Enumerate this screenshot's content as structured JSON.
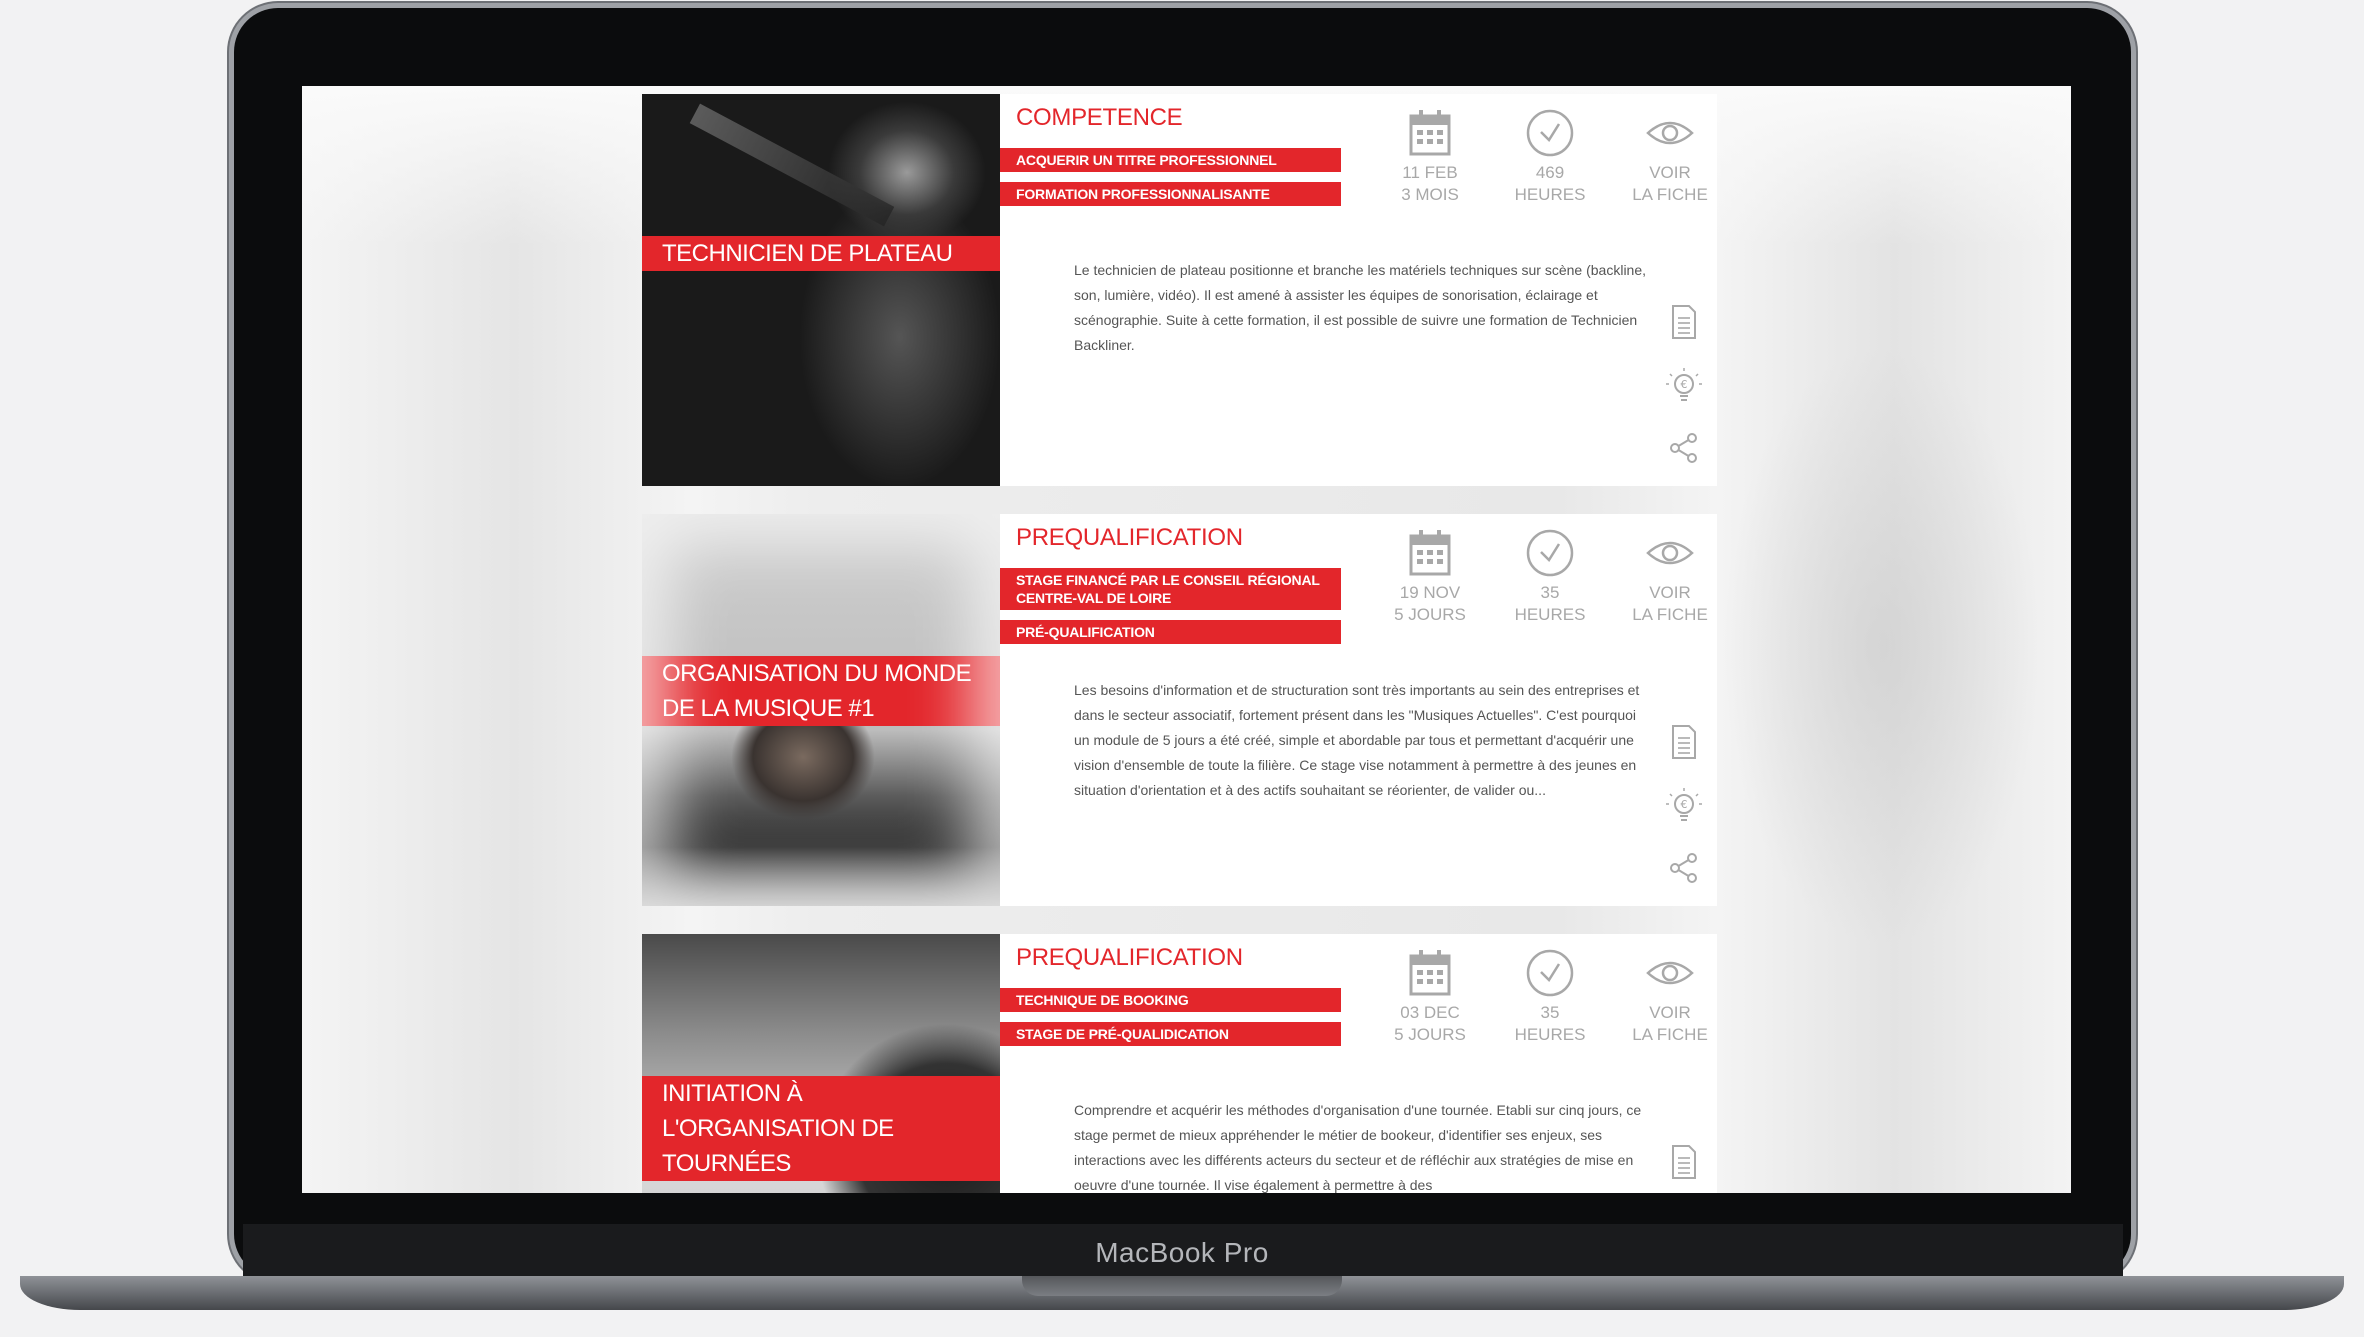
{
  "device": {
    "brand_label": "MacBook Pro"
  },
  "courses": [
    {
      "title": "TECHNICIEN DE PLATEAU",
      "category": "COMPETENCE",
      "tags": [
        "ACQUERIR UN TITRE PROFESSIONNEL",
        "FORMATION PROFESSIONNALISANTE"
      ],
      "date_line1": "11 FEB",
      "date_line2": "3 MOIS",
      "hours_value": "469",
      "hours_label": "HEURES",
      "view_line1": "VOIR",
      "view_line2": "LA FICHE",
      "description": "Le technicien de plateau positionne et branche les matériels techniques sur scène (backline, son, lumière, vidéo). Il est amené à assister les équipes de sonorisation, éclairage et scénographie. Suite à cette formation, il est possible de suivre une formation de Technicien Backliner."
    },
    {
      "title": "ORGANISATION DU MONDE DE LA MUSIQUE #1",
      "category": "PREQUALIFICATION",
      "tags": [
        "STAGE FINANCÉ PAR LE CONSEIL RÉGIONAL CENTRE-VAL DE LOIRE",
        "PRÉ-QUALIFICATION"
      ],
      "date_line1": "19 NOV",
      "date_line2": "5 JOURS",
      "hours_value": "35",
      "hours_label": "HEURES",
      "view_line1": "VOIR",
      "view_line2": "LA FICHE",
      "description": "Les besoins d'information et de structuration sont très importants au sein des entreprises et dans le secteur associatif, fortement présent dans les \"Musiques Actuelles\". C'est pourquoi un module de 5 jours a été créé, simple et abordable par tous et permettant d'acquérir une vision d'ensemble de toute la filière. Ce stage vise notamment à permettre à des jeunes en situation d'orientation et à des actifs souhaitant se réorienter, de valider ou..."
    },
    {
      "title": "INITIATION À L'ORGANISATION DE TOURNÉES",
      "category": "PREQUALIFICATION",
      "tags": [
        "TECHNIQUE DE BOOKING",
        "STAGE DE PRÉ-QUALIDICATION"
      ],
      "date_line1": "03 DEC",
      "date_line2": "5 JOURS",
      "hours_value": "35",
      "hours_label": "HEURES",
      "view_line1": "VOIR",
      "view_line2": "LA FICHE",
      "description": "Comprendre et acquérir les méthodes d'organisation d'une tournée. Etabli sur cinq jours, ce stage permet de mieux appréhender le métier de bookeur, d'identifier ses enjeux, ses interactions avec les différents acteurs du secteur et de réfléchir aux stratégies de mise en oeuvre d'une tournée. Il vise également à permettre à des"
    }
  ],
  "icons": {
    "calendar": "calendar-icon",
    "clock": "clock-icon",
    "eye": "eye-icon",
    "document": "document-icon",
    "funding": "funding-bulb-icon",
    "share": "share-icon"
  },
  "colors": {
    "accent": "#e3262b",
    "meta_grey": "#a8a8a8",
    "text": "#555555"
  }
}
